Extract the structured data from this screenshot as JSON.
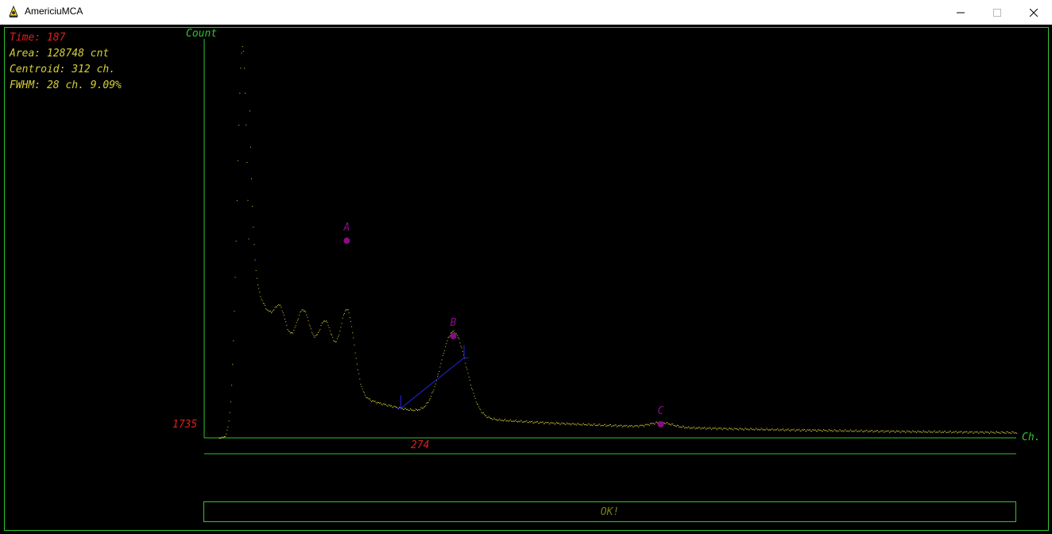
{
  "window": {
    "title": "AmericiuMCA",
    "minimize_icon": "minimize-icon",
    "maximize_icon": "maximize-icon",
    "close_icon": "close-icon"
  },
  "stats": {
    "time": "Time: 187",
    "area": "Area: 128748 cnt",
    "centroid": "Centroid: 312 ch.",
    "fwhm": "FWHM: 28 ch. 9.09%"
  },
  "axes": {
    "ylabel": "Count",
    "xlabel": "Ch.",
    "cursor_count": "1735",
    "cursor_channel": "274"
  },
  "markers": [
    {
      "label": "A",
      "channel": 254,
      "count": 6550
    },
    {
      "label": "B",
      "channel": 313,
      "count": 3380
    },
    {
      "label": "C",
      "channel": 428,
      "count": 450
    }
  ],
  "roi": {
    "start_channel": 284,
    "end_channel": 319
  },
  "status": {
    "message": "OK!"
  },
  "colors": {
    "accent_green": "#2ec52e",
    "spectrum_yellow": "#d6cf3a",
    "marker_purple": "#8a0a8a",
    "roi_blue": "#2424e6",
    "value_red": "#e01e1e"
  },
  "chart_data": {
    "type": "scatter",
    "title": "",
    "xlabel": "Ch.",
    "ylabel": "Count",
    "xlim": [
      175,
      625
    ],
    "ylim": [
      0,
      13200
    ],
    "peaks": [
      {
        "channel": 196,
        "count": 13000,
        "width": 3
      },
      {
        "channel": 217,
        "count": 900,
        "width": 3
      },
      {
        "channel": 230,
        "count": 1700,
        "width": 4
      },
      {
        "channel": 242,
        "count": 1900,
        "width": 4
      },
      {
        "channel": 254,
        "count": 2700,
        "width": 4
      },
      {
        "channel": 313,
        "count": 2800,
        "width": 7
      },
      {
        "channel": 428,
        "count": 150,
        "width": 6
      }
    ]
  }
}
